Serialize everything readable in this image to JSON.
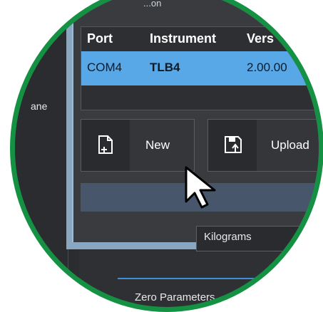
{
  "background_pane": {
    "label": "ane"
  },
  "dialog": {
    "title": "...on",
    "table": {
      "headers": [
        "Port",
        "Instrument",
        "Vers"
      ],
      "selected_row": {
        "port": "COM4",
        "instrument": "TLB4",
        "version": "2.00.00"
      }
    },
    "buttons": {
      "new_label": "New",
      "upload_label": "Upload"
    }
  },
  "units_select": {
    "value": "Kilograms"
  },
  "tab": {
    "label": "Zero Parameters"
  },
  "colors": {
    "selection": "#58a7e6",
    "accent": "#3f8fd8",
    "ring": "#159143"
  }
}
